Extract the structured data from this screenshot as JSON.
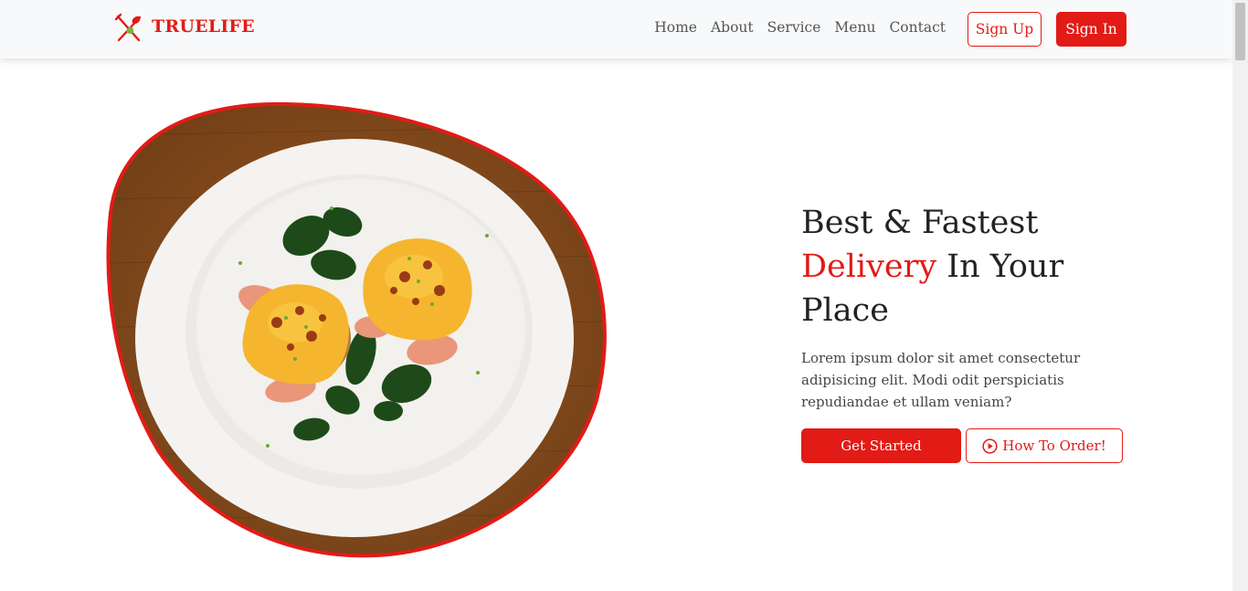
{
  "brand": {
    "name": "TRUELIFE",
    "logo_icon": "fork-spoon-icon",
    "color": "#e21b16"
  },
  "nav": {
    "links": [
      "Home",
      "About",
      "Service",
      "Menu",
      "Contact"
    ],
    "signup_label": "Sign Up",
    "signin_label": "Sign In"
  },
  "hero": {
    "title_line1": "Best & Fastest",
    "title_accent": "Delivery",
    "title_rest": " In Your",
    "title_line3": "Place",
    "description": "Lorem ipsum dolor sit amet consectetur adipisicing elit. Modi odit perspiciatis repudiandae et ullam veniam?",
    "primary_button": "Get Started",
    "secondary_button": "How To Order!",
    "secondary_icon": "play-circle-icon",
    "image_subject": "eggs-benedict-plate-image"
  },
  "colors": {
    "accent": "#e21b16",
    "navbar_bg": "#f8f9fa",
    "text": "#222222"
  }
}
